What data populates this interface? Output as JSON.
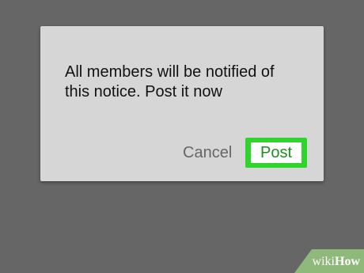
{
  "dialog": {
    "message": "All members will be notified of this notice. Post it now",
    "cancel_label": "Cancel",
    "post_label": "Post"
  },
  "watermark": {
    "prefix": "wiki",
    "suffix": "How"
  },
  "colors": {
    "background": "#666666",
    "dialog": "#d6d6d6",
    "highlight": "#2fd52c",
    "post_text": "#1e8f1e",
    "cancel_text": "#666666"
  }
}
